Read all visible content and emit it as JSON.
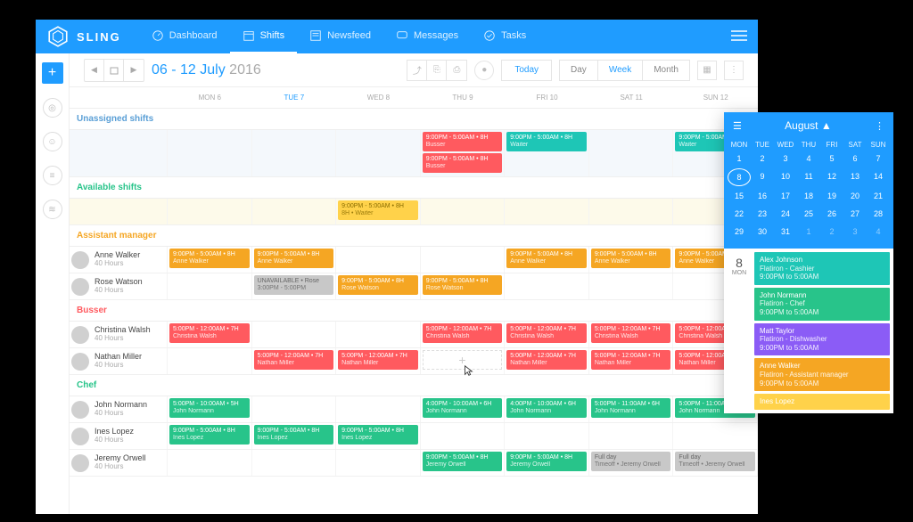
{
  "brand": "SLING",
  "nav": {
    "dashboard": "Dashboard",
    "shifts": "Shifts",
    "newsfeed": "Newsfeed",
    "messages": "Messages",
    "tasks": "Tasks"
  },
  "toolbar": {
    "date_blue": "06 - 12 July",
    "date_grey": "2016",
    "today": "Today",
    "day": "Day",
    "week": "Week",
    "month": "Month"
  },
  "days": {
    "mon": "MON 6",
    "tue": "TUE 7",
    "wed": "WED 8",
    "thu": "THU 9",
    "fri": "FRI 10",
    "sat": "SAT 11",
    "sun": "SUN 12"
  },
  "sections": {
    "unassigned": "Unassigned shifts",
    "available": "Available shifts",
    "asst_mgr": "Assistant manager",
    "busser": "Busser",
    "chef": "Chef"
  },
  "people": {
    "anne": {
      "name": "Anne Walker",
      "hours": "40 Hours"
    },
    "rose": {
      "name": "Rose Watson",
      "hours": "40 Hours"
    },
    "christina": {
      "name": "Christina Walsh",
      "hours": "40 Hours"
    },
    "nathan": {
      "name": "Nathan Miller",
      "hours": "40 Hours"
    },
    "john": {
      "name": "John Normann",
      "hours": "40 Hours"
    },
    "ines": {
      "name": "Ines Lopez",
      "hours": "40 Hours"
    },
    "jeremy": {
      "name": "Jeremy Orwell",
      "hours": "40 Hours"
    }
  },
  "chips": {
    "t9_5_8h": "9:00PM - 5:00AM • 8H",
    "t5_12_7h": "5:00PM - 12:00AM • 7H",
    "t5_10_5h": "5:00PM - 10:00AM • 5H",
    "t4_10_6h": "4:00PM - 10:00AM • 6H",
    "t5_11_6h": "5:00PM - 11:00AM • 6H",
    "full_day": "Full day",
    "unavail": "UNAVAILABLE • Rose",
    "unavail_time": "3:00PM - 5:00PM",
    "busser_sub": "Busser",
    "waiter_sub": "Waiter",
    "anne_sub": "Anne Walker",
    "rose_sub": "Rose Watson",
    "christina_sub": "Christina Walsh",
    "nathan_sub": "Nathan Miller",
    "john_sub": "John Normann",
    "ines_sub": "Ines Lopez",
    "jeremy_sub": "Jeremy Orwell",
    "avail_sub": "8H • Waiter",
    "timeoff_sub": "Timeoff • Jeremy Orwell"
  },
  "calendar": {
    "title": "August ▲",
    "dow": [
      "MON",
      "TUE",
      "WED",
      "THU",
      "FRI",
      "SAT",
      "SUN"
    ],
    "cells": [
      "1",
      "2",
      "3",
      "4",
      "5",
      "6",
      "7",
      "8",
      "9",
      "10",
      "11",
      "12",
      "13",
      "14",
      "15",
      "16",
      "17",
      "18",
      "19",
      "20",
      "21",
      "22",
      "23",
      "24",
      "25",
      "26",
      "27",
      "28",
      "29",
      "30",
      "31",
      "1",
      "2",
      "3",
      "4"
    ],
    "selected": "8",
    "selected_dow": "MON",
    "events": [
      {
        "cls": "c-teal",
        "n": "Alex Johnson",
        "r": "Flatiron - Cashier",
        "t": "9:00PM to 5:00AM"
      },
      {
        "cls": "c-green",
        "n": "John Normann",
        "r": "Flatiron - Chef",
        "t": "9:00PM to 5:00AM"
      },
      {
        "cls": "c-purple",
        "n": "Matt Taylor",
        "r": "Flatiron - Dishwasher",
        "t": "9:00PM to 5:00AM"
      },
      {
        "cls": "c-orange",
        "n": "Anne Walker",
        "r": "Flatiron - Assistant manager",
        "t": "9:00PM to 5:00AM"
      },
      {
        "cls": "c-ylw",
        "n": "Ines Lopez",
        "r": "",
        "t": ""
      }
    ]
  }
}
